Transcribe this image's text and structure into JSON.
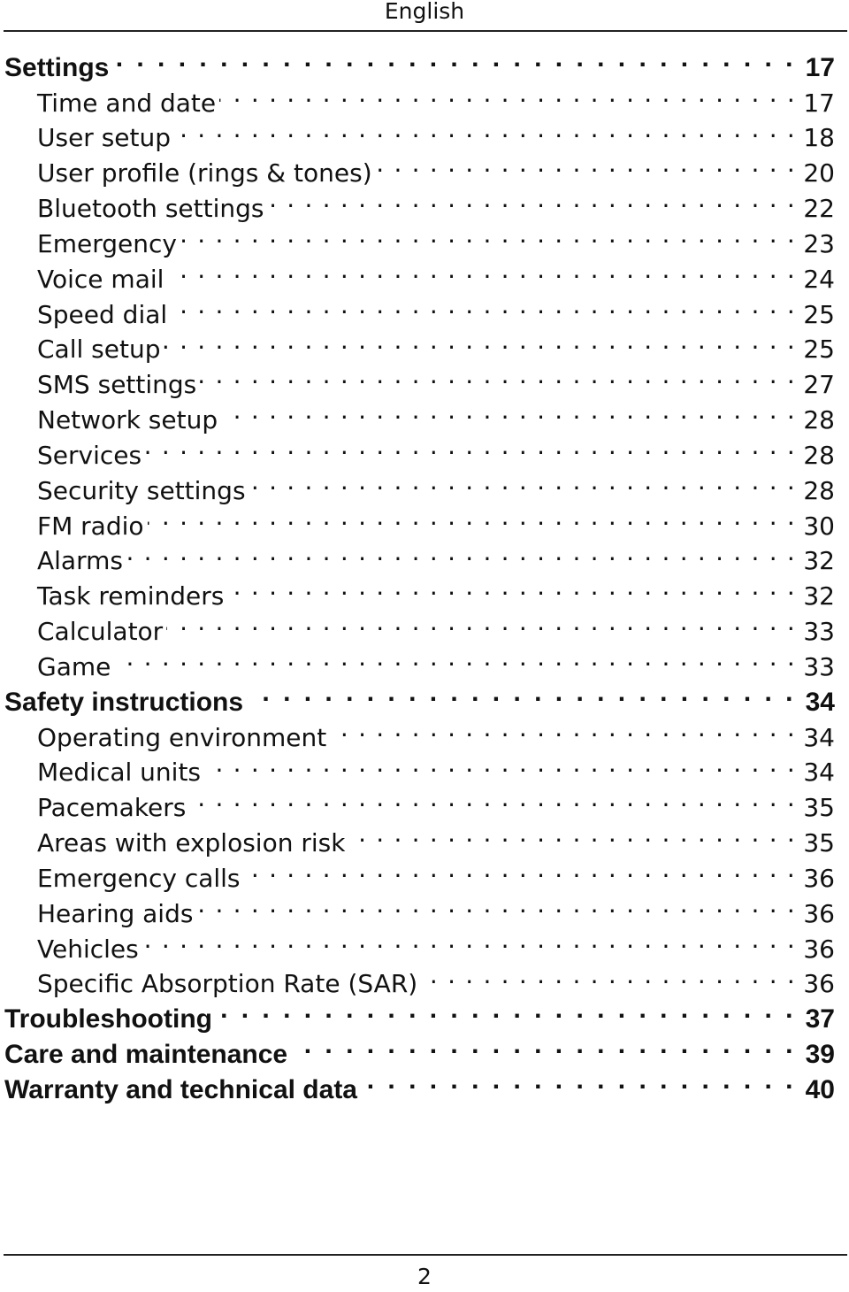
{
  "header": {
    "language": "English"
  },
  "toc": [
    {
      "title": "Settings",
      "page": "17",
      "level": 1
    },
    {
      "title": "Time and date",
      "page": "17",
      "level": 2
    },
    {
      "title": "User setup",
      "page": "18",
      "level": 2
    },
    {
      "title": "User profile (rings & tones)",
      "page": "20",
      "level": 2
    },
    {
      "title": "Bluetooth settings",
      "page": "22",
      "level": 2
    },
    {
      "title": "Emergency",
      "page": "23",
      "level": 2
    },
    {
      "title": "Voice mail",
      "page": "24",
      "level": 2
    },
    {
      "title": "Speed dial",
      "page": "25",
      "level": 2
    },
    {
      "title": "Call setup",
      "page": "25",
      "level": 2
    },
    {
      "title": "SMS settings",
      "page": "27",
      "level": 2
    },
    {
      "title": "Network setup",
      "page": "28",
      "level": 2
    },
    {
      "title": "Services",
      "page": "28",
      "level": 2
    },
    {
      "title": "Security settings",
      "page": "28",
      "level": 2
    },
    {
      "title": "FM radio",
      "page": "30",
      "level": 2
    },
    {
      "title": "Alarms",
      "page": "32",
      "level": 2
    },
    {
      "title": "Task reminders",
      "page": "32",
      "level": 2
    },
    {
      "title": "Calculator",
      "page": "33",
      "level": 2
    },
    {
      "title": "Game",
      "page": "33",
      "level": 2
    },
    {
      "title": "Safety instructions",
      "page": "34",
      "level": 1
    },
    {
      "title": "Operating environment",
      "page": "34",
      "level": 2
    },
    {
      "title": "Medical units",
      "page": "34",
      "level": 2
    },
    {
      "title": "Pacemakers",
      "page": "35",
      "level": 2
    },
    {
      "title": "Areas with explosion risk",
      "page": "35",
      "level": 2
    },
    {
      "title": "Emergency calls",
      "page": "36",
      "level": 2
    },
    {
      "title": "Hearing aids",
      "page": "36",
      "level": 2
    },
    {
      "title": "Vehicles",
      "page": "36",
      "level": 2
    },
    {
      "title": "Specific Absorption Rate (SAR)",
      "page": "36",
      "level": 2
    },
    {
      "title": "Troubleshooting",
      "page": "37",
      "level": 1
    },
    {
      "title": "Care and maintenance",
      "page": "39",
      "level": 1
    },
    {
      "title": "Warranty and technical data",
      "page": "40",
      "level": 1
    }
  ],
  "footer": {
    "page_number": "2"
  }
}
